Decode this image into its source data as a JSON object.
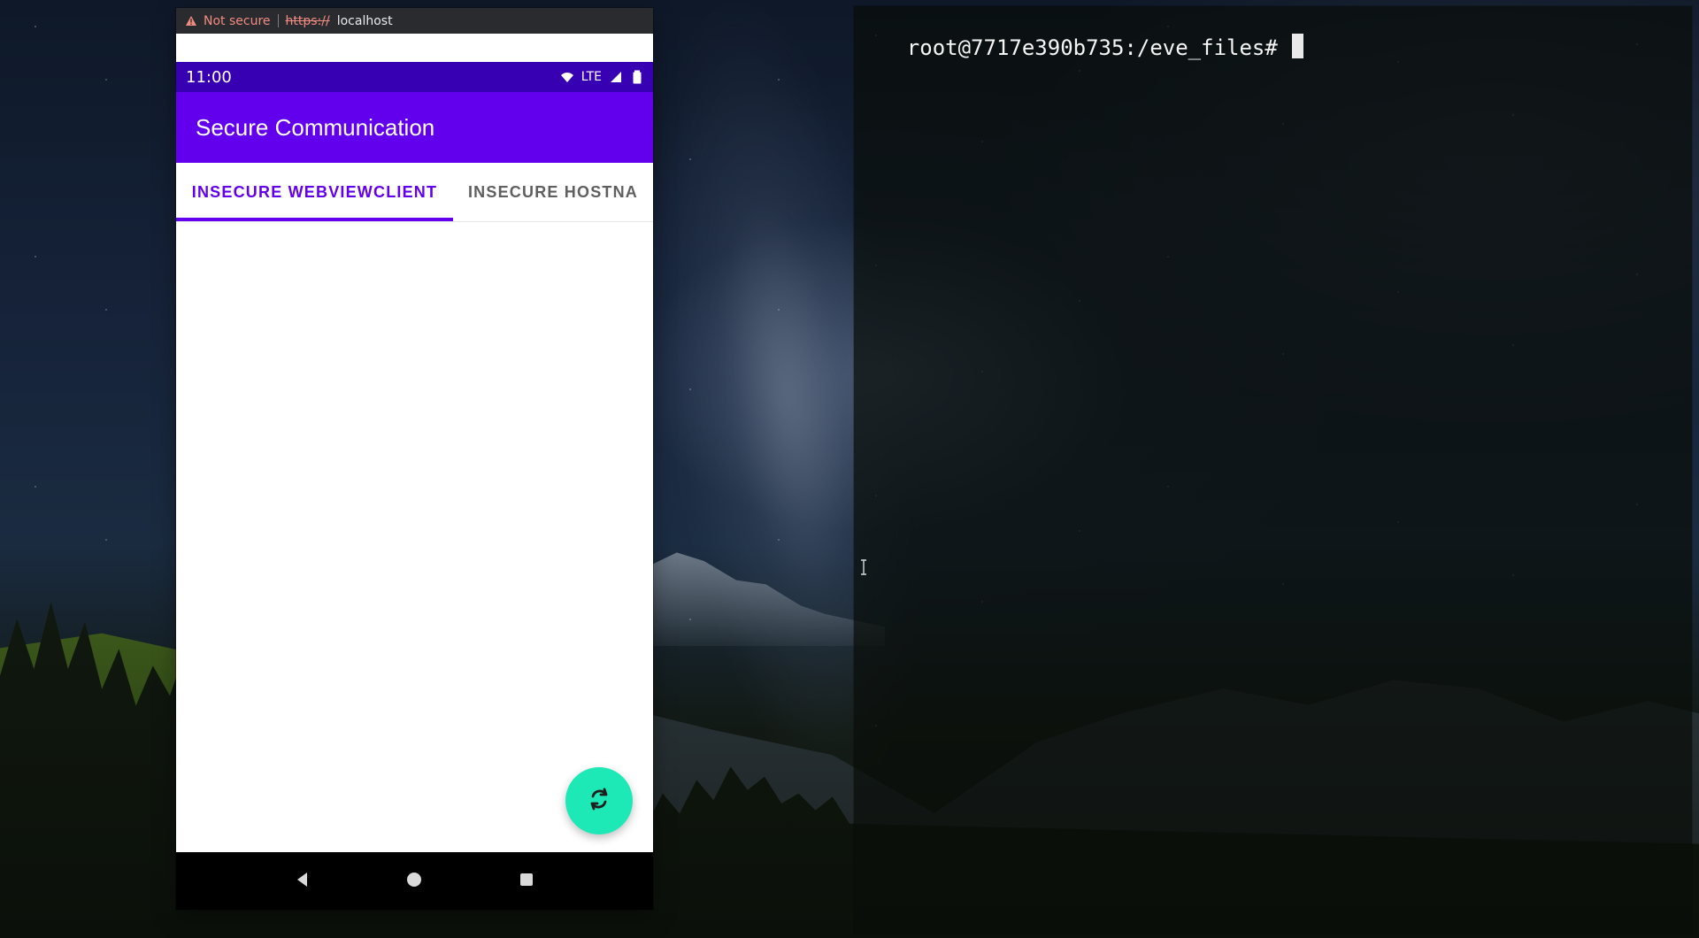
{
  "browser": {
    "warning_text": "Not secure",
    "url_scheme": "https://",
    "url_host": "localhost"
  },
  "android": {
    "time": "11:00",
    "network": "LTE",
    "app_title": "Secure Communication",
    "tabs": [
      {
        "label": "INSECURE WEBVIEWCLIENT"
      },
      {
        "label": "INSECURE HOSTNA"
      }
    ]
  },
  "terminal": {
    "prompt": "root@7717e390b735:/eve_files# "
  },
  "colors": {
    "primary": "#6200ee",
    "status": "#3700b3",
    "fab": "#1de9b6",
    "terminal_text": "#f5f5f5"
  },
  "icons": {
    "warning": "warning-icon",
    "wifi": "wifi-icon",
    "signal": "signal-icon",
    "battery": "battery-icon",
    "sync": "sync-icon",
    "back": "back-icon",
    "home": "home-icon",
    "recent": "recent-apps-icon"
  }
}
